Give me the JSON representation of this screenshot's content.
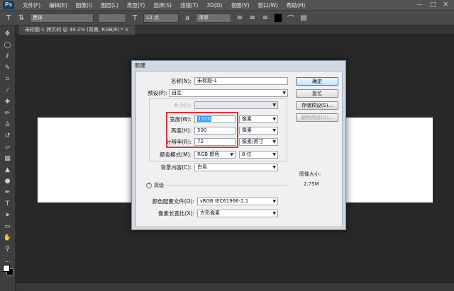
{
  "app": {
    "logo": "Ps"
  },
  "menu": [
    "文件(F)",
    "编辑(E)",
    "图像(I)",
    "图层(L)",
    "类型(Y)",
    "选择(S)",
    "滤镜(T)",
    "3D(D)",
    "视图(V)",
    "窗口(W)",
    "帮助(H)"
  ],
  "window_controls": {
    "minimize": "—",
    "maximize": "□",
    "close": "✕"
  },
  "options": {
    "tool_icon": "T",
    "font_family": "黑体",
    "font_size": "12 点",
    "antialias": "浑厚"
  },
  "document_tab": "未标题-1 拷贝的 @ 49.2% (背景, RGB/8) *  ×",
  "dialog": {
    "title": "新建",
    "name_label": "名称(N):",
    "name_value": "未标题-1",
    "preset_label": "预设(P):",
    "preset_value": "自定",
    "size_label": "大小(I):",
    "width_label": "宽度(W):",
    "width_value": "1920",
    "width_unit": "像素",
    "height_label": "高度(H):",
    "height_value": "500",
    "height_unit": "像素",
    "resolution_label": "分辨率(R):",
    "resolution_value": "72",
    "resolution_unit": "像素/英寸",
    "color_mode_label": "颜色模式(M):",
    "color_mode_value": "RGB 颜色",
    "bit_depth": "8 位",
    "background_label": "背景内容(C):",
    "background_value": "白色",
    "advanced_label": "高级",
    "color_profile_label": "颜色配置文件(O):",
    "color_profile_value": "sRGB IEC61966-2.1",
    "pixel_aspect_label": "像素长宽比(X):",
    "pixel_aspect_value": "方形像素",
    "ok_button": "确定",
    "reset_button": "复位",
    "save_preset_button": "存储预设(S)...",
    "delete_preset_button": "删除预设(D)...",
    "image_size_label": "图像大小:",
    "image_size_value": "2.75M"
  },
  "colors": {
    "highlight_box": "#d9343a",
    "selection": "#3399ff"
  }
}
